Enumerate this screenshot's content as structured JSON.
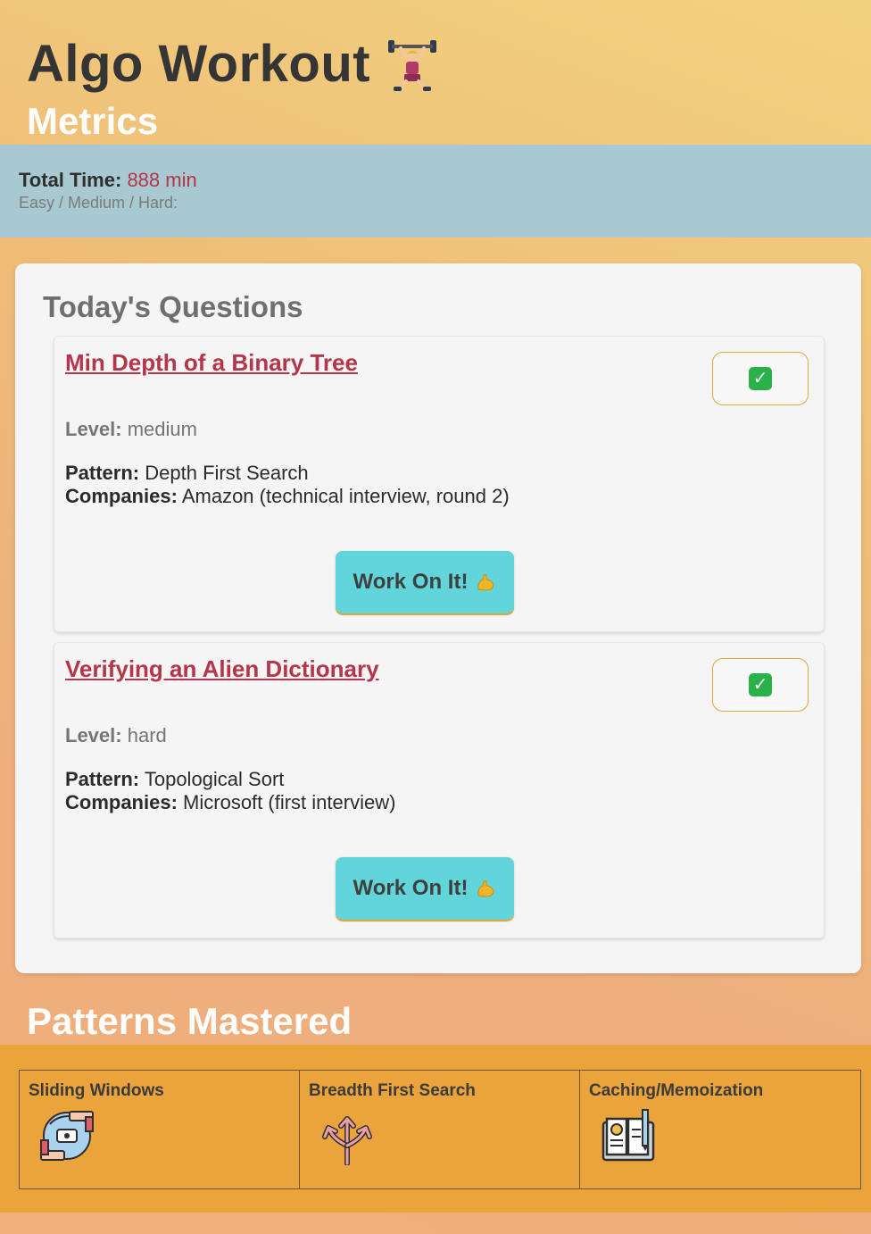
{
  "header": {
    "title": "Algo Workout",
    "title_icon": "weightlifter-icon",
    "metrics_heading": "Metrics"
  },
  "metrics": {
    "total_time_label": "Total Time:",
    "total_time_value": "888 min",
    "difficulty_label": "Easy / Medium / Hard:"
  },
  "questions": {
    "heading": "Today's Questions",
    "items": [
      {
        "title": "Min Depth of a Binary Tree",
        "level_label": "Level:",
        "level": "medium",
        "pattern_label": "Pattern:",
        "pattern": "Depth First Search",
        "companies_label": "Companies:",
        "companies": "Amazon (technical interview, round 2)",
        "button_label": "Work On It!",
        "completed": true
      },
      {
        "title": "Verifying an Alien Dictionary",
        "level_label": "Level:",
        "level": "hard",
        "pattern_label": "Pattern:",
        "pattern": "Topological Sort",
        "companies_label": "Companies:",
        "companies": "Microsoft (first interview)",
        "button_label": "Work On It!",
        "completed": true
      }
    ]
  },
  "patterns": {
    "heading": "Patterns Mastered",
    "items": [
      {
        "name": "Sliding Windows",
        "icon": "sliding-windows-icon"
      },
      {
        "name": "Breadth First Search",
        "icon": "branching-arrows-icon"
      },
      {
        "name": "Caching/Memoization",
        "icon": "notebook-icon"
      }
    ]
  },
  "colors": {
    "accent_red": "#b5364b",
    "metrics_bar": "#a8c8d2",
    "patterns_bar": "#eba33c",
    "button": "#62d5da"
  }
}
